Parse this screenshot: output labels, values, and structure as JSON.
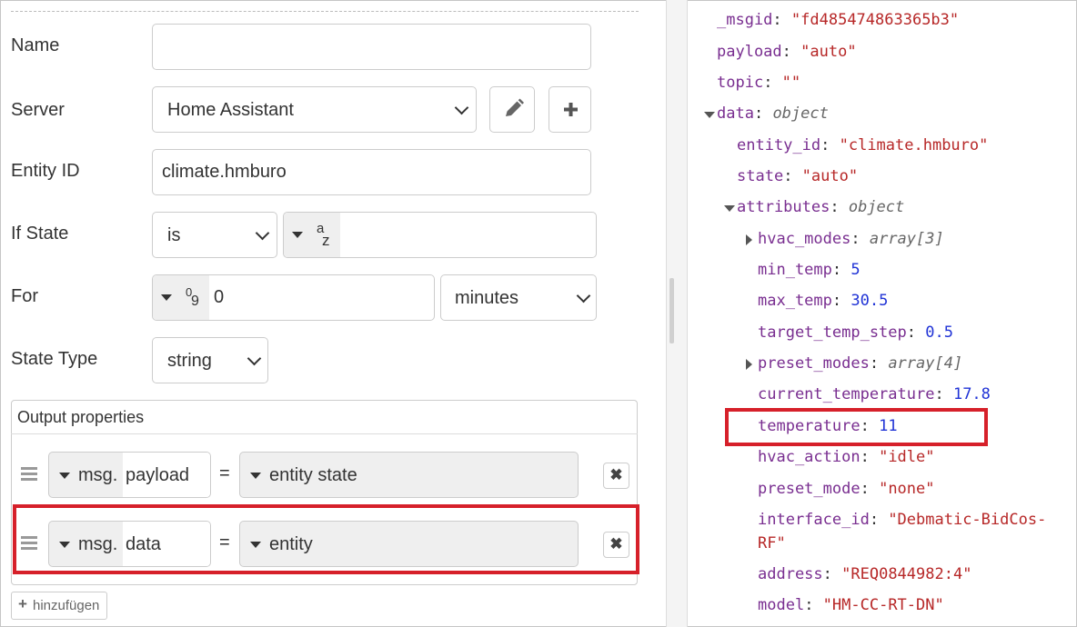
{
  "form": {
    "name_label": "Name",
    "name_value": "",
    "server_label": "Server",
    "server_value": "Home Assistant",
    "entity_label": "Entity ID",
    "entity_value": "climate.hmburo",
    "ifstate_label": "If State",
    "ifstate_op": "is",
    "ifstate_type_top": "a",
    "ifstate_type_bottom": "z",
    "ifstate_value": "",
    "for_label": "For",
    "for_type_top": "0",
    "for_type_bottom": "9",
    "for_value": "0",
    "for_unit": "minutes",
    "statetype_label": "State Type",
    "statetype_value": "string"
  },
  "output": {
    "title": "Output properties",
    "rows": [
      {
        "prefix": "msg.",
        "prop": "payload",
        "equals": "=",
        "value": "entity state",
        "highlighted": false
      },
      {
        "prefix": "msg.",
        "prop": "data",
        "equals": "=",
        "value": "entity",
        "highlighted": true
      }
    ],
    "add_label": "hinzufügen",
    "add_icon": "+",
    "remove_icon": "✖"
  },
  "debug": {
    "lines": [
      {
        "key": "_msgid",
        "sep": ": ",
        "value": "\"fd485474863365b3\"",
        "kind": "s"
      },
      {
        "key": "payload",
        "sep": ": ",
        "value": "\"auto\"",
        "kind": "s"
      },
      {
        "key": "topic",
        "sep": ": ",
        "value": "\"\"",
        "kind": "s"
      },
      {
        "key": "data",
        "sep": ": ",
        "value": "object",
        "kind": "t"
      },
      {
        "key": "entity_id",
        "sep": ": ",
        "value": "\"climate.hmburo\"",
        "kind": "s"
      },
      {
        "key": "state",
        "sep": ": ",
        "value": "\"auto\"",
        "kind": "s"
      },
      {
        "key": "attributes",
        "sep": ": ",
        "value": "object",
        "kind": "t"
      },
      {
        "key": "hvac_modes",
        "sep": ": ",
        "value": "array[3]",
        "kind": "t"
      },
      {
        "key": "min_temp",
        "sep": ": ",
        "value": "5",
        "kind": "n"
      },
      {
        "key": "max_temp",
        "sep": ": ",
        "value": "30.5",
        "kind": "n"
      },
      {
        "key": "target_temp_step",
        "sep": ": ",
        "value": "0.5",
        "kind": "n"
      },
      {
        "key": "preset_modes",
        "sep": ": ",
        "value": "array[4]",
        "kind": "t"
      },
      {
        "key": "current_temperature",
        "sep": ": ",
        "value": "17.8",
        "kind": "n"
      },
      {
        "key": "temperature",
        "sep": ": ",
        "value": "11",
        "kind": "n",
        "highlighted": true
      },
      {
        "key": "hvac_action",
        "sep": ": ",
        "value": "\"idle\"",
        "kind": "s"
      },
      {
        "key": "preset_mode",
        "sep": ": ",
        "value": "\"none\"",
        "kind": "s"
      },
      {
        "key": "interface_id",
        "sep": ": ",
        "value": "\"Debmatic-BidCos-",
        "kind": "s",
        "cont": "RF\""
      },
      {
        "key": "address",
        "sep": ": ",
        "value": "\"REQ0844982:4\"",
        "kind": "s"
      },
      {
        "key": "model",
        "sep": ": ",
        "value": "\"HM-CC-RT-DN\"",
        "kind": "s"
      }
    ]
  }
}
